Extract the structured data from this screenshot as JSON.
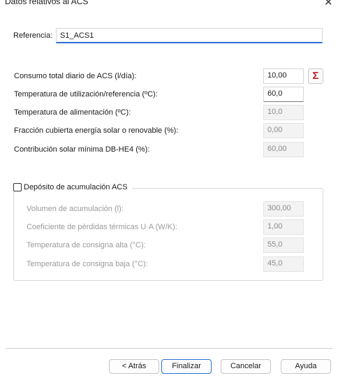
{
  "window": {
    "title": "Datos relativos al ACS",
    "close_glyph": "✕",
    "close_icon": "close-icon"
  },
  "reference": {
    "label": "Referencia:",
    "value": "S1_ACS1"
  },
  "rows": [
    {
      "label": "Consumo total diario de ACS (l/día):",
      "value": "10,00",
      "state": "enabled"
    },
    {
      "label": "Temperatura de utilización/referencia (ºC):",
      "value": "60,0",
      "state": "enabled"
    },
    {
      "label": "Temperatura de alimentación (ºC):",
      "value": "10,0",
      "state": "disabled"
    },
    {
      "label": "Fracción cubierta energía solar o renovable (%):",
      "value": "0,00",
      "state": "disabled"
    },
    {
      "label": "Contribución solar mínima DB-HE4 (%):",
      "value": "60,00",
      "state": "disabled"
    }
  ],
  "sigma_button": {
    "glyph": "Σ",
    "icon": "sigma-icon"
  },
  "deposit": {
    "checkbox_label": "Depósito de acumulación ACS",
    "checked": false,
    "rows": [
      {
        "label": "Volumen de acumulación (l):",
        "value": "300,00"
      },
      {
        "label": "Coeficiente de pérdidas térmicas U·A (W/K):",
        "value": "1,00"
      },
      {
        "label": "Temperatura de consigna alta (°C):",
        "value": "55,0"
      },
      {
        "label": "Temperatura de consigna baja (°C):",
        "value": "45,0"
      }
    ]
  },
  "buttons": {
    "back": "< Atrás",
    "finish": "Finalizar",
    "cancel": "Cancelar",
    "help": "Ayuda"
  }
}
